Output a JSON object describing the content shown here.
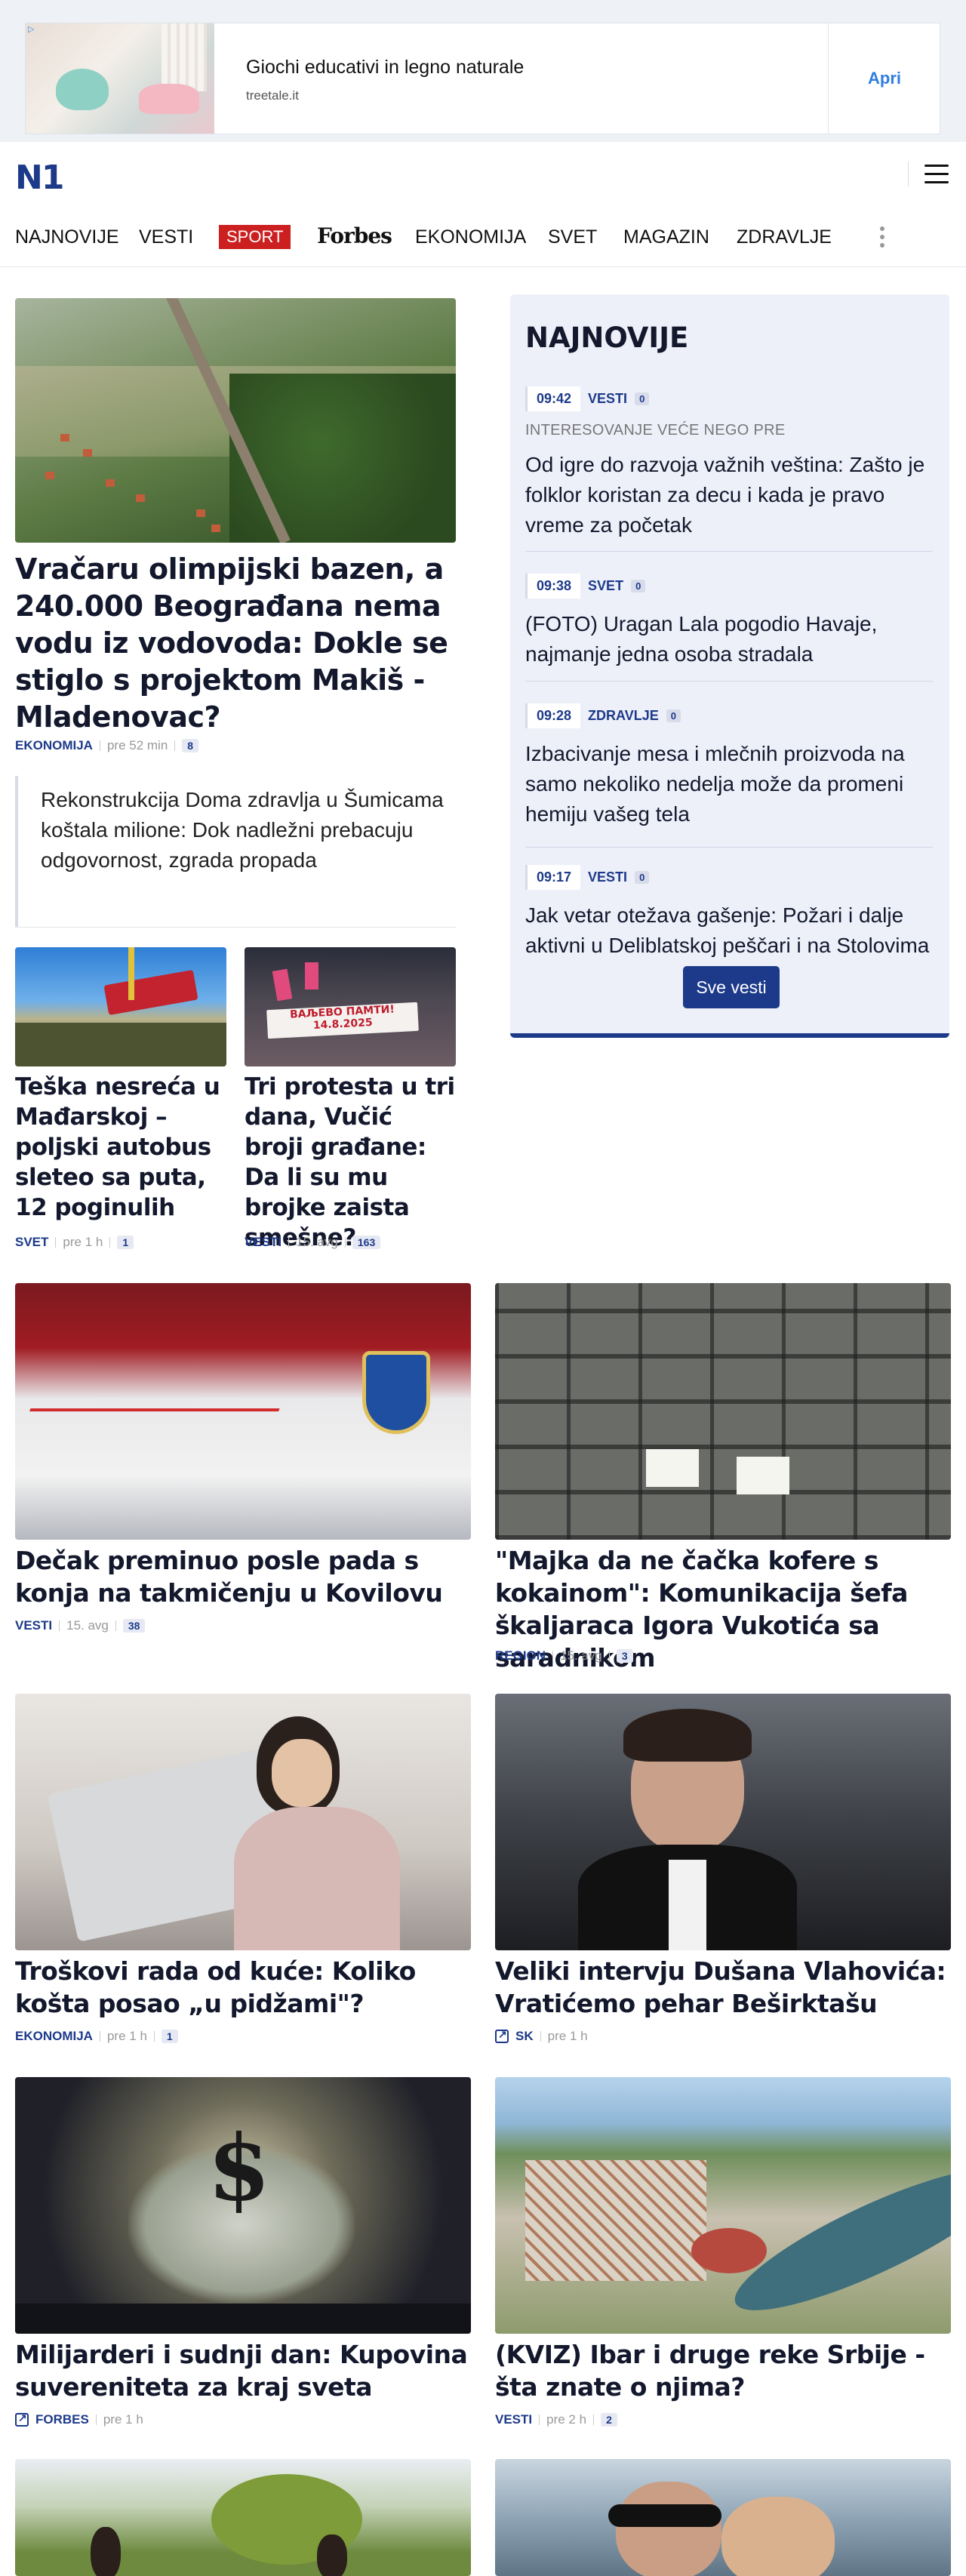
{
  "ad": {
    "choice_icon": "adchoices-icon",
    "title": "Giochi educativi in legno naturale",
    "url": "treetale.it",
    "button": "Apri"
  },
  "header": {
    "logo": "N1"
  },
  "nav": {
    "items": [
      "NAJNOVIJE",
      "VESTI",
      "SPORT",
      "Forbes",
      "EKONOMIJA",
      "SVET",
      "MAGAZIN",
      "ZDRAVLJE"
    ]
  },
  "featured": {
    "title": "Vračaru olimpijski bazen, a 240.000 Beograđana nema vodu iz vodovoda: Dokle se stiglo s projektom Makiš - Mladenovac?",
    "category": "EKONOMIJA",
    "time": "pre 52 min",
    "comments": "8",
    "related": "Rekonstrukcija Doma zdravlja u Šumicama koštala milione: Dok nadležni prebacuju odgovornost, zgrada propada"
  },
  "small_articles": [
    {
      "title": "Teška nesreća u Mađarskoj – poljski autobus sleteo sa puta, 12 poginulih",
      "category": "SVET",
      "time": "pre 1 h",
      "comments": "1"
    },
    {
      "title": "Tri protesta u tri dana, Vučić broji građane: Da li su mu brojke zaista smešne?",
      "category": "VESTI",
      "time": "15. avg",
      "comments": "163",
      "banner": "ВАЉЕВО ПАМТИ!",
      "banner_date": "14.8.2025"
    }
  ],
  "latest": {
    "heading": "NAJNOVIJE",
    "items": [
      {
        "time": "09:42",
        "category": "VESTI",
        "comments": "0",
        "supertitle": "INTERESOVANJE VEĆE NEGO PRE",
        "title": "Od igre do razvoja važnih veština: Zašto je folklor koristan za decu i kada je pravo vreme za početak"
      },
      {
        "time": "09:38",
        "category": "SVET",
        "comments": "0",
        "title": "(FOTO) Uragan Lala pogodio Havaje, najmanje jedna osoba stradala"
      },
      {
        "time": "09:28",
        "category": "ZDRAVLJE",
        "comments": "0",
        "title": "Izbacivanje mesa i mlečnih proizvoda na samo nekoliko nedelja može da promeni hemiju vašeg tela"
      },
      {
        "time": "09:17",
        "category": "VESTI",
        "comments": "0",
        "title": "Jak vetar otežava gašenje: Požari i dalje aktivni u Deliblatskoj peščari i na Stolovima"
      }
    ],
    "button": "Sve vesti"
  },
  "grid": [
    {
      "title": "Dečak preminuo posle pada s konja na takmičenju u Kovilovu",
      "category": "VESTI",
      "time": "15. avg",
      "comments": "38"
    },
    {
      "title": "\"Majka da ne čačka kofere s kokainom\": Komunikacija šefa škaljaraca Igora Vukotića sa saradnikom",
      "category": "REGION",
      "time": "15. avg",
      "comments": "3"
    },
    {
      "title": "Troškovi rada od kuće: Koliko košta posao „u pidžami\"?",
      "category": "EKONOMIJA",
      "time": "pre 1 h",
      "comments": "1"
    },
    {
      "title": "Veliki intervju Dušana Vlahovića: Vratićemo pehar Beširktašu",
      "category": "SK",
      "time": "pre 1 h",
      "external": true
    },
    {
      "title": "Milijarderi i sudnji dan: Kupovina suvereniteta za kraj sveta",
      "category": "FORBES",
      "time": "pre 1 h",
      "external": true
    },
    {
      "title": "(KVIZ) Ibar i druge reke Srbije - šta znate o njima?",
      "category": "VESTI",
      "time": "pre 2 h",
      "comments": "2"
    }
  ],
  "colors": {
    "brand": "#1d3a8a",
    "sport": "#cc1f1f",
    "sidebar_bg": "#edf0f9"
  }
}
